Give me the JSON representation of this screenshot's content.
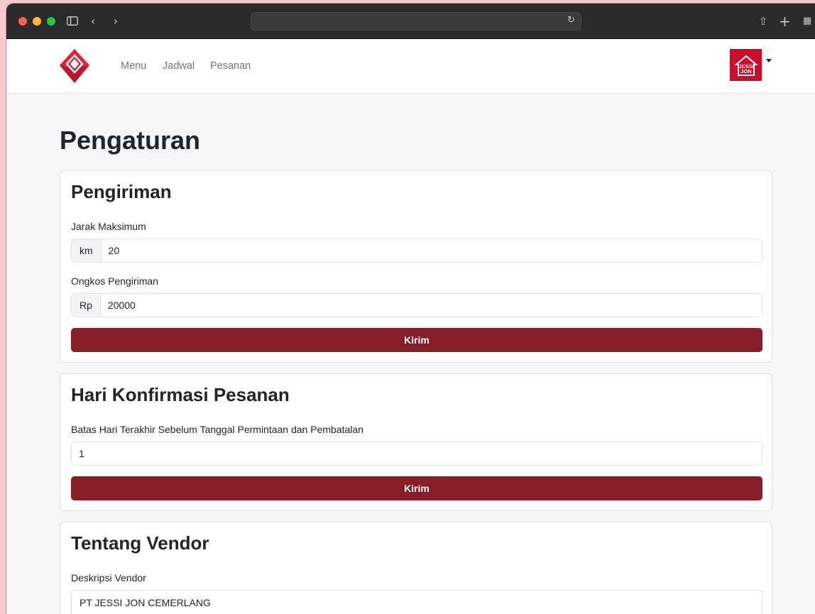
{
  "browser": {
    "icons": {
      "sidebar": "sidebar-icon",
      "back": "chevron-left-icon",
      "forward": "chevron-right-icon",
      "reload": "reload-icon",
      "share": "share-icon",
      "new_tab": "plus-icon",
      "tabs": "tab-overview-icon"
    }
  },
  "navbar": {
    "links": [
      "Menu",
      "Jadwal",
      "Pesanan"
    ],
    "brand_color": "#c8102e",
    "avatar_text_top": "JESSI",
    "avatar_text_bottom": "JON"
  },
  "page": {
    "title": "Pengaturan"
  },
  "pengiriman": {
    "title": "Pengiriman",
    "jarak_label": "Jarak Maksimum",
    "jarak_unit": "km",
    "jarak_value": "20",
    "ongkos_label": "Ongkos Pengiriman",
    "ongkos_unit": "Rp",
    "ongkos_value": "20000",
    "submit_label": "Kirim"
  },
  "konfirmasi": {
    "title": "Hari Konfirmasi Pesanan",
    "batas_label": "Batas Hari Terakhir Sebelum Tanggal Permintaan dan Pembatalan",
    "batas_value": "1",
    "submit_label": "Kirim"
  },
  "vendor": {
    "title": "Tentang Vendor",
    "deskripsi_label": "Deskripsi Vendor",
    "deskripsi_value": "PT JESSI JON CEMERLANG"
  },
  "colors": {
    "primary_button": "#861e2a",
    "background": "#f5f6f8"
  }
}
